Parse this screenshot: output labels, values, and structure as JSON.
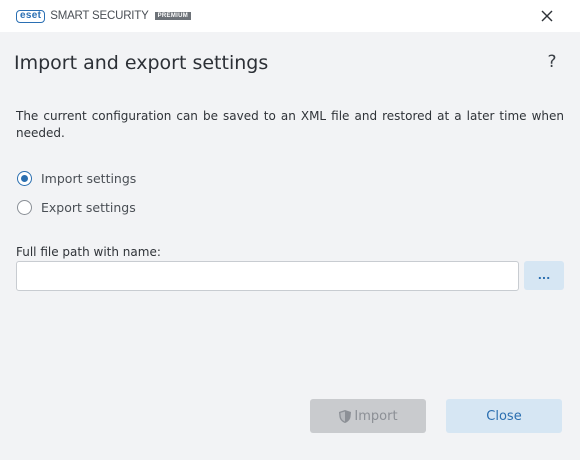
{
  "window": {
    "logo_text": "eset",
    "product_name": "SMART SECURITY",
    "edition": "PREMIUM",
    "close_icon": "close-icon"
  },
  "header": {
    "title": "Import and export settings",
    "help_label": "?"
  },
  "description": "The current configuration can be saved to an XML file and restored at a later time when needed.",
  "options": [
    {
      "label": "Import settings",
      "selected": true
    },
    {
      "label": "Export settings",
      "selected": false
    }
  ],
  "file_path": {
    "label": "Full file path with name:",
    "value": "",
    "placeholder": "",
    "browse_label": "..."
  },
  "footer": {
    "import_label": "Import",
    "import_enabled": false,
    "import_icon": "shield-icon",
    "close_label": "Close"
  },
  "colors": {
    "accent": "#2b6fb0",
    "background": "#f2f3f5",
    "button_secondary_bg": "#d6e6f3",
    "button_disabled_bg": "#c9cbce"
  }
}
